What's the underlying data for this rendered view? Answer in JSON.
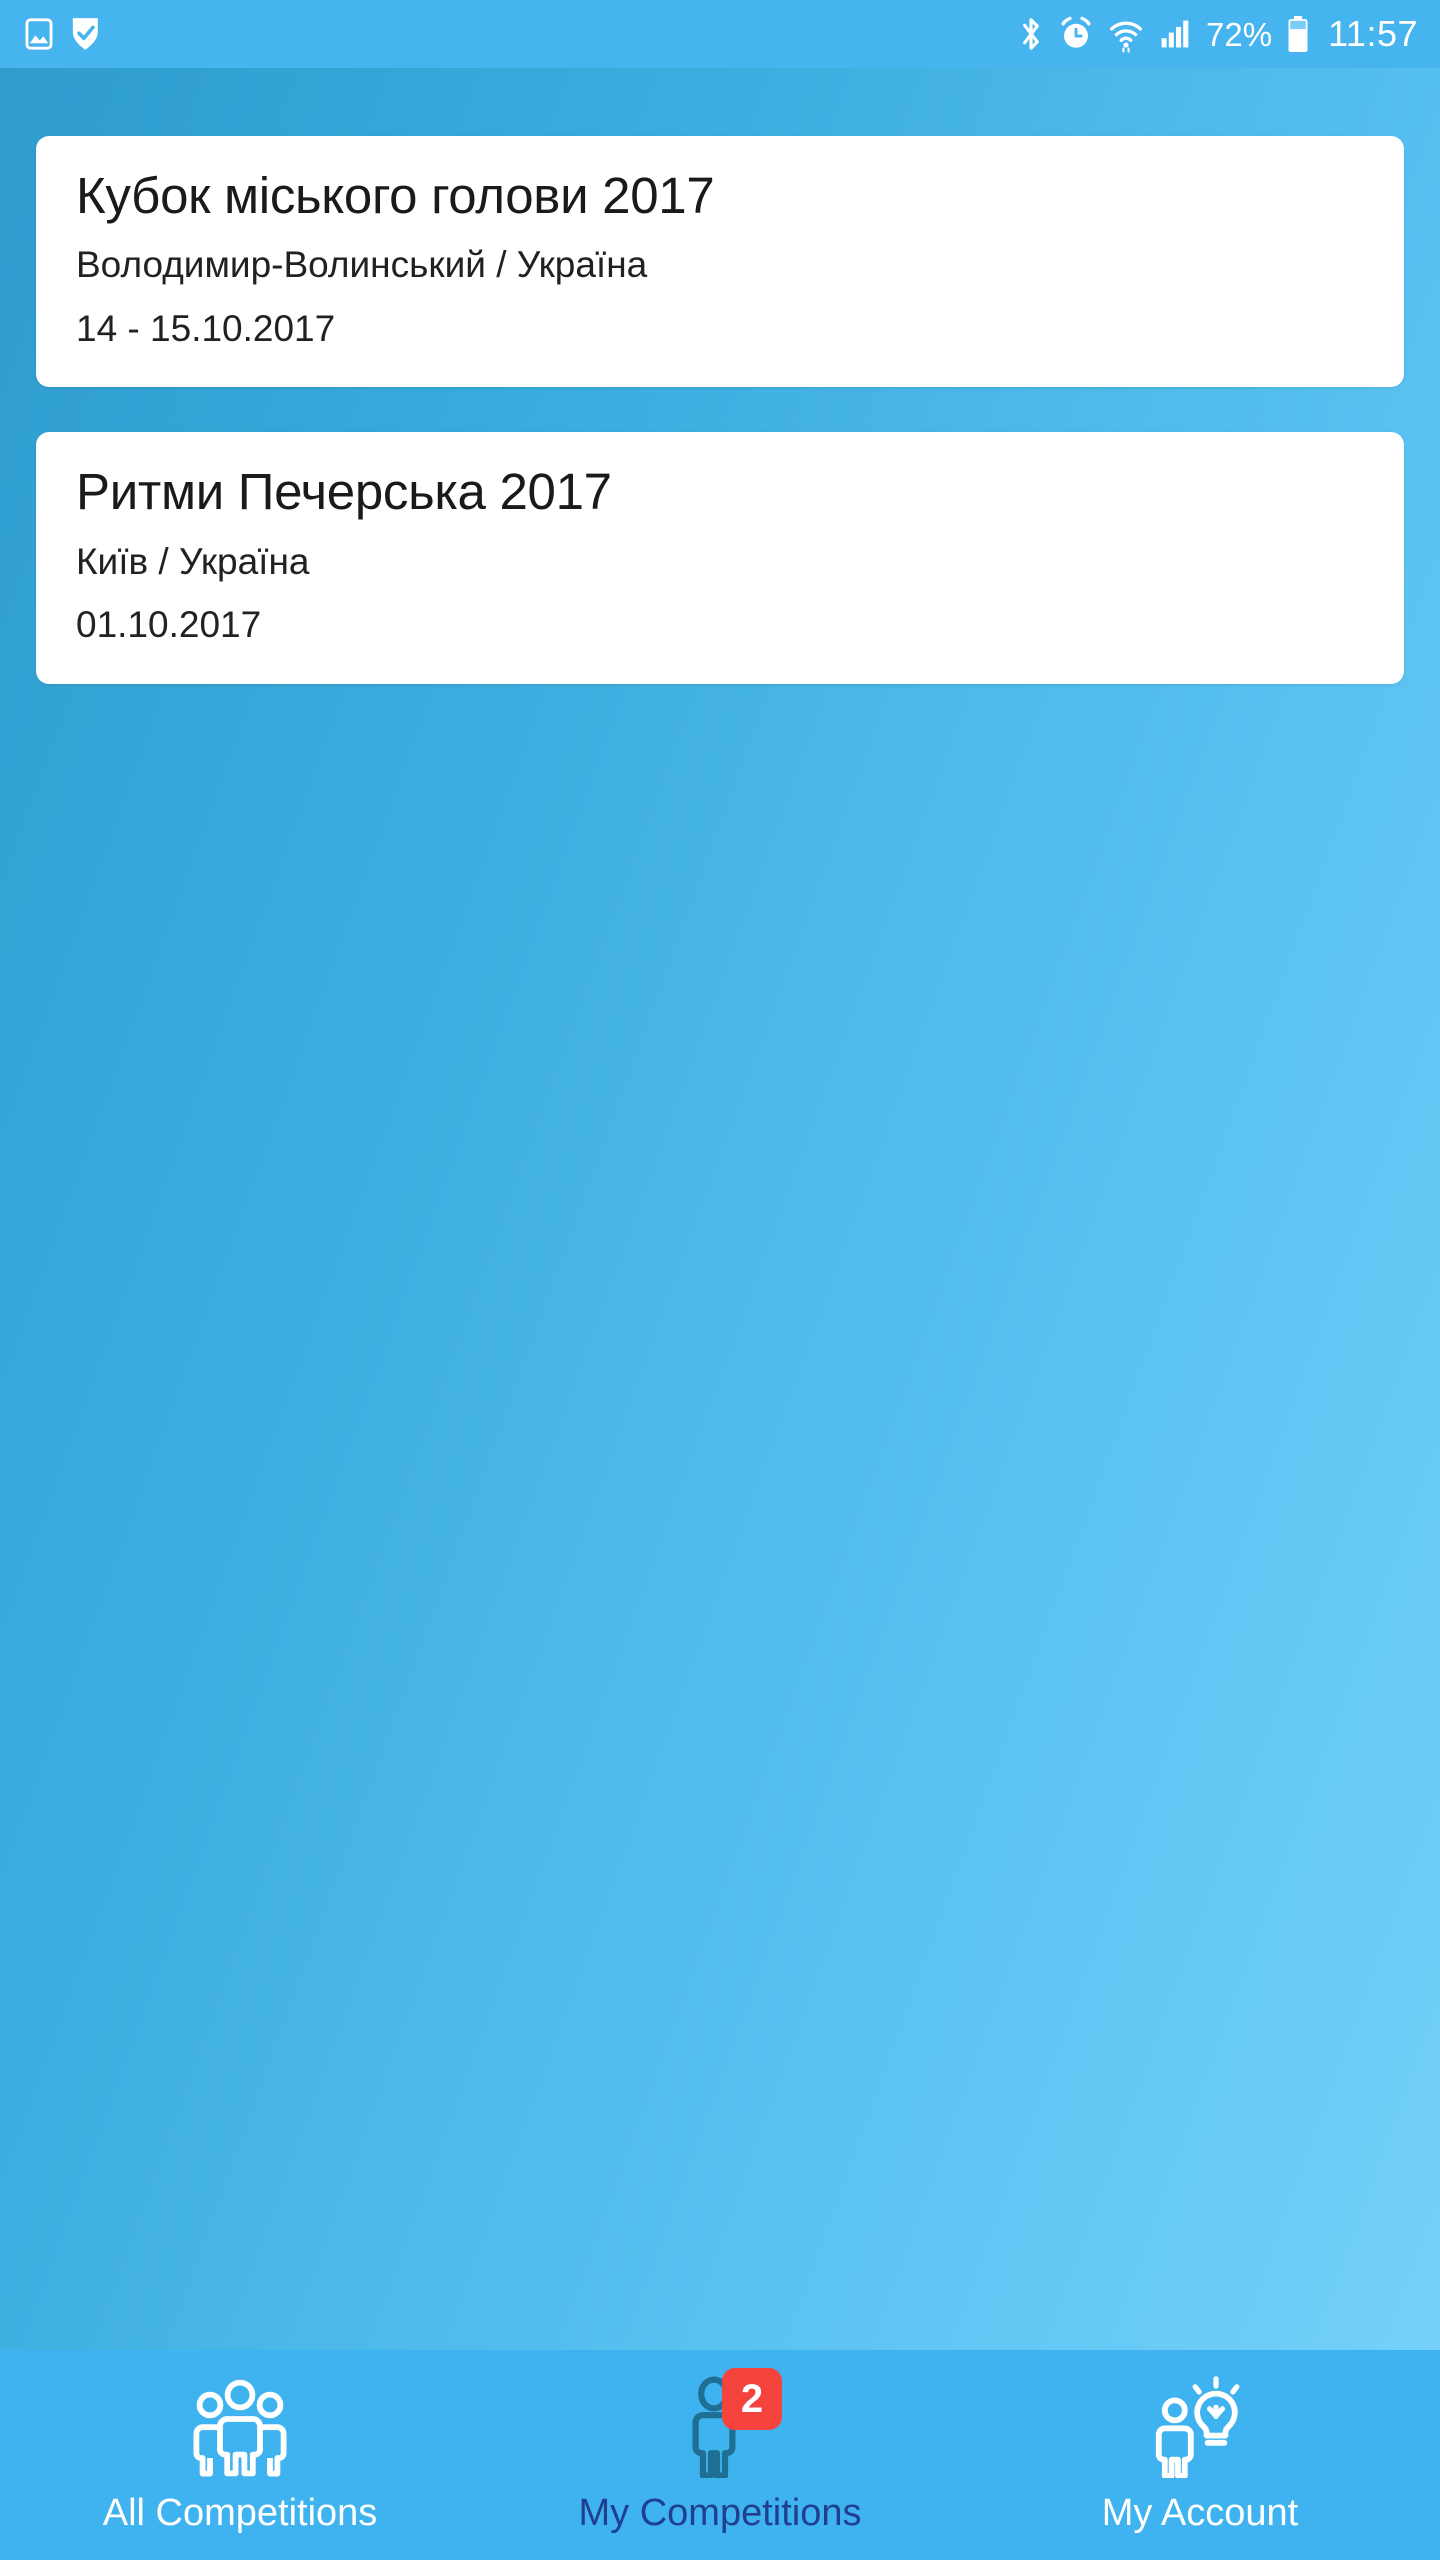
{
  "statusbar": {
    "left_icons": [
      {
        "name": "gallery-image-icon"
      },
      {
        "name": "shield-check-icon"
      }
    ],
    "right_icons": [
      {
        "name": "bluetooth-icon"
      },
      {
        "name": "alarm-clock-icon"
      },
      {
        "name": "wifi-icon"
      },
      {
        "name": "cellular-signal-icon"
      }
    ],
    "battery_percent": "72%",
    "battery_icon": "battery-icon",
    "clock": "11:57",
    "background_color": "#46b4ef",
    "foreground_color": "#ffffff"
  },
  "screen": {
    "background_gradient_from": "#2e9ccd",
    "background_gradient_to": "#77d2fb"
  },
  "competitions": [
    {
      "title": "Кубок міського голови 2017",
      "location": "Володимир-Волинський / Україна",
      "date": "14 - 15.10.2017"
    },
    {
      "title": "Ритми Печерська 2017",
      "location": "Київ / Україна",
      "date": "01.10.2017"
    }
  ],
  "bottom_nav": {
    "background_color": "#3fb3f0",
    "active_label_color": "#1f3f8f",
    "inactive_label_color": "#ffffff",
    "badge_color": "#f4433c",
    "items": [
      {
        "label": "All Competitions",
        "icon": "group-people-icon",
        "active": false,
        "badge": null
      },
      {
        "label": "My Competitions",
        "icon": "single-person-icon",
        "active": true,
        "badge": "2"
      },
      {
        "label": "My Account",
        "icon": "person-lightbulb-icon",
        "active": false,
        "badge": null
      }
    ]
  }
}
